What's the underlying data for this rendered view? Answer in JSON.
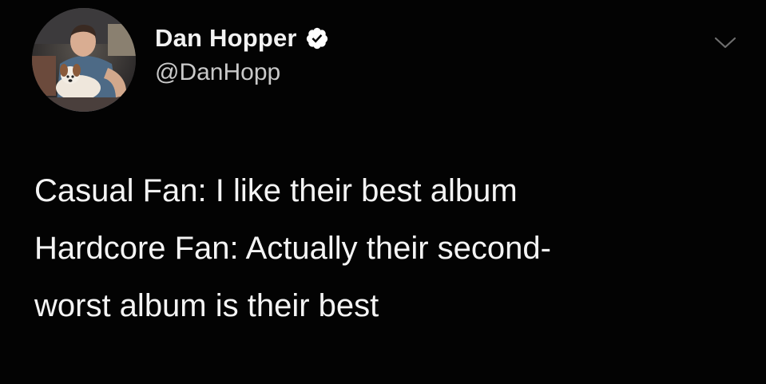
{
  "author": {
    "display_name": "Dan Hopper",
    "handle": "@DanHopp",
    "verified": true,
    "avatar_icon": "profile-photo-icon",
    "verified_icon": "verified-badge-icon"
  },
  "menu": {
    "icon": "chevron-down-icon"
  },
  "tweet": {
    "lines": [
      "Casual Fan: I like their best album",
      "Hardcore Fan: Actually their second-",
      "worst album is their best"
    ]
  },
  "colors": {
    "background": "#030303",
    "text": "#f4f4f4",
    "handle": "#c9c9c9",
    "chevron": "#6e6e6e"
  }
}
